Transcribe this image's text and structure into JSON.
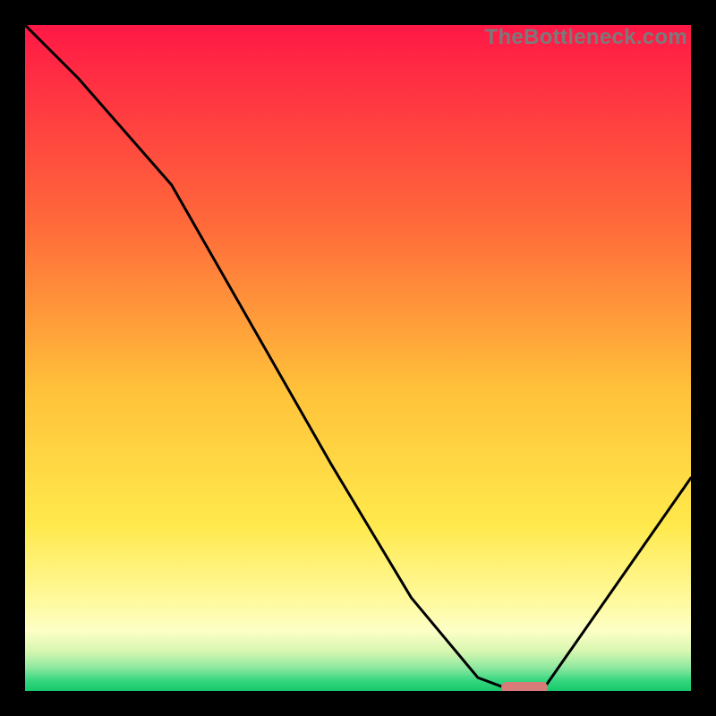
{
  "watermark": "TheBottleneck.com",
  "chart_data": {
    "type": "line",
    "title": "",
    "xlabel": "",
    "ylabel": "",
    "xlim": [
      0,
      100
    ],
    "ylim": [
      0,
      100
    ],
    "x": [
      0,
      8,
      22,
      46,
      58,
      68,
      72,
      78,
      100
    ],
    "values": [
      100,
      92,
      76,
      34,
      14,
      2,
      0.5,
      0.5,
      32
    ],
    "optimal_marker_x": [
      72,
      78
    ],
    "grid": false
  },
  "gradient_stops": [
    {
      "offset": 0,
      "color": "#ff1846"
    },
    {
      "offset": 0.3,
      "color": "#ff6a3a"
    },
    {
      "offset": 0.55,
      "color": "#ffc23a"
    },
    {
      "offset": 0.75,
      "color": "#ffe94c"
    },
    {
      "offset": 0.86,
      "color": "#fff99a"
    },
    {
      "offset": 0.91,
      "color": "#fdffc6"
    },
    {
      "offset": 0.94,
      "color": "#d8f7b0"
    },
    {
      "offset": 0.965,
      "color": "#8ee8a0"
    },
    {
      "offset": 0.985,
      "color": "#34d67f"
    },
    {
      "offset": 1.0,
      "color": "#17c86a"
    }
  ]
}
